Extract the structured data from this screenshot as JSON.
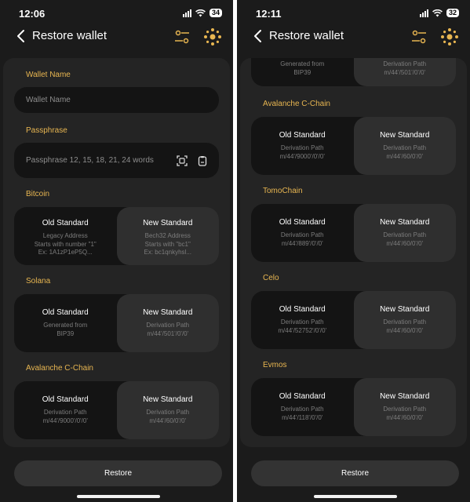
{
  "left": {
    "status": {
      "time": "12:06",
      "battery": "34"
    },
    "header": {
      "title": "Restore wallet"
    },
    "wallet_name": {
      "label": "Wallet Name",
      "placeholder": "Wallet Name"
    },
    "passphrase": {
      "label": "Passphrase",
      "placeholder": "Passphrase 12, 15, 18, 21, 24 words"
    },
    "sections": [
      {
        "label": "Bitcoin",
        "options": [
          {
            "title": "Old Standard",
            "lines": [
              "Legacy Address",
              "Starts with number \"1\"",
              "Ex: 1A1zP1eP5Q..."
            ]
          },
          {
            "title": "New Standard",
            "lines": [
              "Bech32 Address",
              "Starts with \"bc1\"",
              "Ex: bc1qnkyhsl..."
            ]
          }
        ]
      },
      {
        "label": "Solana",
        "options": [
          {
            "title": "Old Standard",
            "lines": [
              "Generated from",
              "BIP39"
            ]
          },
          {
            "title": "New Standard",
            "lines": [
              "Derivation Path",
              "m/44'/501'/0'/0'"
            ]
          }
        ]
      },
      {
        "label": "Avalanche C-Chain",
        "options": [
          {
            "title": "Old Standard",
            "lines": [
              "Derivation Path",
              "m/44'/9000'/0'/0'"
            ]
          },
          {
            "title": "New Standard",
            "lines": [
              "Derivation Path",
              "m/44'/60/0'/0'"
            ]
          }
        ]
      }
    ],
    "restore_label": "Restore"
  },
  "right": {
    "status": {
      "time": "12:11",
      "battery": "32"
    },
    "header": {
      "title": "Restore wallet"
    },
    "partial": {
      "options": [
        {
          "lines": [
            "Generated from",
            "BIP39"
          ]
        },
        {
          "lines": [
            "Derivation Path",
            "m/44'/501'/0'/0'"
          ]
        }
      ]
    },
    "sections": [
      {
        "label": "Avalanche C-Chain",
        "options": [
          {
            "title": "Old Standard",
            "lines": [
              "Derivation Path",
              "m/44'/9000'/0'/0'"
            ]
          },
          {
            "title": "New Standard",
            "lines": [
              "Derivation Path",
              "m/44'/60/0'/0'"
            ]
          }
        ]
      },
      {
        "label": "TomoChain",
        "options": [
          {
            "title": "Old Standard",
            "lines": [
              "Derivation Path",
              "m/44'/889'/0'/0'"
            ]
          },
          {
            "title": "New Standard",
            "lines": [
              "Derivation Path",
              "m/44'/60/0'/0'"
            ]
          }
        ]
      },
      {
        "label": "Celo",
        "options": [
          {
            "title": "Old Standard",
            "lines": [
              "Derivation Path",
              "m/44'/52752'/0'/0'"
            ]
          },
          {
            "title": "New Standard",
            "lines": [
              "Derivation Path",
              "m/44'/60/0'/0'"
            ]
          }
        ]
      },
      {
        "label": "Evmos",
        "options": [
          {
            "title": "Old Standard",
            "lines": [
              "Derivation Path",
              "m/44'/118'/0'/0'"
            ]
          },
          {
            "title": "New Standard",
            "lines": [
              "Derivation Path",
              "m/44'/60/0'/0'"
            ]
          }
        ]
      }
    ],
    "restore_label": "Restore"
  },
  "icons": {
    "back": "chevron-left-icon",
    "filter": "sliders-icon",
    "avatar": "dots-logo-icon",
    "scan": "scan-icon",
    "paste": "clipboard-icon"
  },
  "colors": {
    "accent": "#e8b651",
    "background": "#1b1b1b",
    "panel": "#242424",
    "input": "#141414",
    "selected": "#2f2f2f"
  }
}
